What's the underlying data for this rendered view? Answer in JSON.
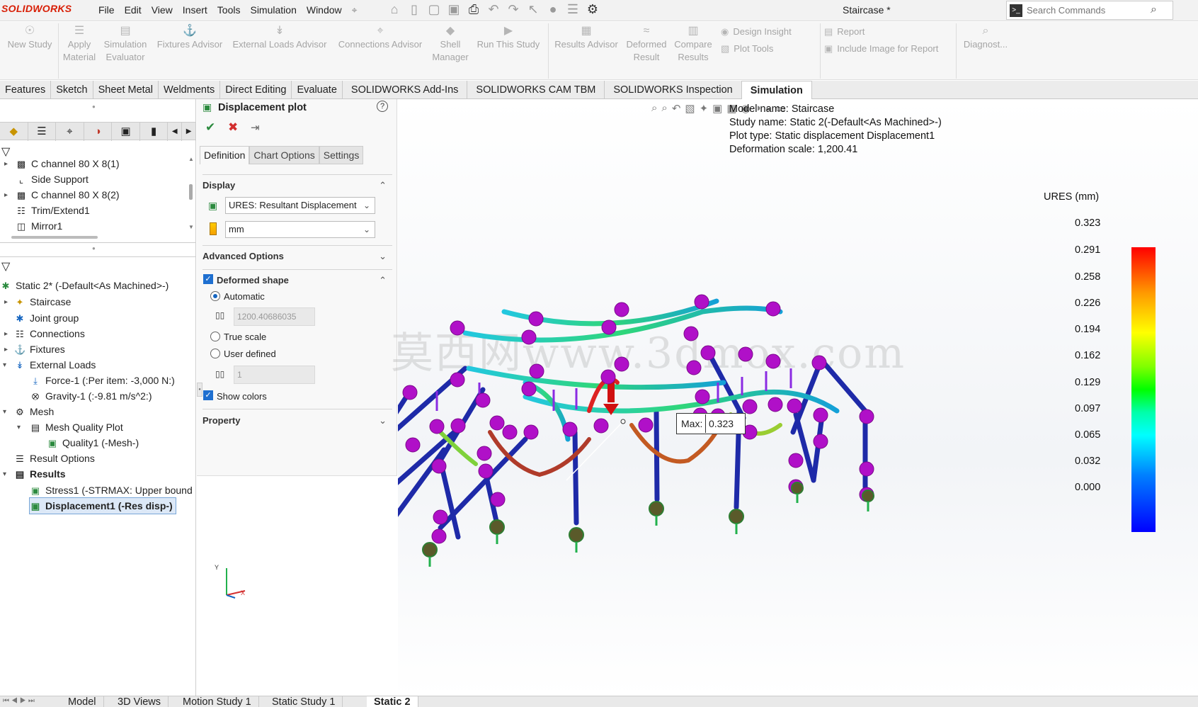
{
  "app": {
    "logo": "SOLIDWORKS",
    "doc_title": "Staircase *"
  },
  "menus": [
    "File",
    "Edit",
    "View",
    "Insert",
    "Tools",
    "Simulation",
    "Window"
  ],
  "search": {
    "placeholder": "Search Commands"
  },
  "ribbon": {
    "new_study": "New Study",
    "apply_material_1": "Apply",
    "apply_material_2": "Material",
    "sim_eval_1": "Simulation",
    "sim_eval_2": "Evaluator",
    "fixtures_advisor": "Fixtures Advisor",
    "external_loads_advisor": "External Loads Advisor",
    "connections_advisor": "Connections Advisor",
    "shell_manager_1": "Shell",
    "shell_manager_2": "Manager",
    "run_study": "Run This Study",
    "results_advisor": "Results Advisor",
    "deformed_result_1": "Deformed",
    "deformed_result_2": "Result",
    "compare_results_1": "Compare",
    "compare_results_2": "Results",
    "design_insight": "Design Insight",
    "plot_tools": "Plot Tools",
    "report": "Report",
    "include_image": "Include Image for Report",
    "diagnostics": "Diagnost..."
  },
  "command_tabs": [
    "Features",
    "Sketch",
    "Sheet Metal",
    "Weldments",
    "Direct Editing",
    "Evaluate",
    "SOLIDWORKS Add-Ins",
    "SOLIDWORKS CAM TBM",
    "SOLIDWORKS Inspection",
    "Simulation"
  ],
  "feature_tree": [
    {
      "label": "C channel 80 X 8(1)"
    },
    {
      "label": "Side Support"
    },
    {
      "label": "C channel 80 X 8(2)"
    },
    {
      "label": "Trim/Extend1"
    },
    {
      "label": "Mirror1"
    }
  ],
  "sim_tree": [
    {
      "label": "Static 2* (-Default<As Machined>-)"
    },
    {
      "label": "Staircase"
    },
    {
      "label": "Joint group"
    },
    {
      "label": "Connections"
    },
    {
      "label": "Fixtures"
    },
    {
      "label": "External Loads"
    },
    {
      "label": "Force-1 (:Per item: -3,000 N:)"
    },
    {
      "label": "Gravity-1 (:-9.81 m/s^2:)"
    },
    {
      "label": "Mesh"
    },
    {
      "label": "Mesh Quality Plot"
    },
    {
      "label": "Quality1 (-Mesh-)"
    },
    {
      "label": "Result Options"
    },
    {
      "label": "Results"
    },
    {
      "label": "Stress1 (-STRMAX: Upper bound"
    },
    {
      "label": "Displacement1 (-Res disp-)"
    }
  ],
  "pm": {
    "title": "Displacement plot",
    "tabs": [
      "Definition",
      "Chart Options",
      "Settings"
    ],
    "display_header": "Display",
    "component_value": "URES:   Resultant Displacement",
    "units_value": "mm",
    "advanced_header": "Advanced Options",
    "deformed_header": "Deformed shape",
    "automatic": "Automatic",
    "auto_scale": "1200.40686035",
    "true_scale": "True scale",
    "user_defined": "User defined",
    "user_value": "1",
    "show_colors": "Show colors",
    "property_header": "Property"
  },
  "plot_info": [
    "Model name: Staircase",
    "Study name: Static 2(-Default<As Machined>-)",
    "Plot type: Static displacement Displacement1",
    "Deformation scale: 1,200.41"
  ],
  "legend": {
    "title": "URES (mm)",
    "ticks": [
      "0.323",
      "0.291",
      "0.258",
      "0.226",
      "0.194",
      "0.162",
      "0.129",
      "0.097",
      "0.065",
      "0.032",
      "0.000"
    ]
  },
  "probe": {
    "label": "Max:",
    "value": "0.323"
  },
  "watermark": "莫西网www.3dmox.com",
  "triad": {
    "y": "Y",
    "x": "X"
  },
  "bottom_tabs": [
    "Model",
    "3D Views",
    "Motion Study 1",
    "Static Study 1",
    "Static 2"
  ]
}
